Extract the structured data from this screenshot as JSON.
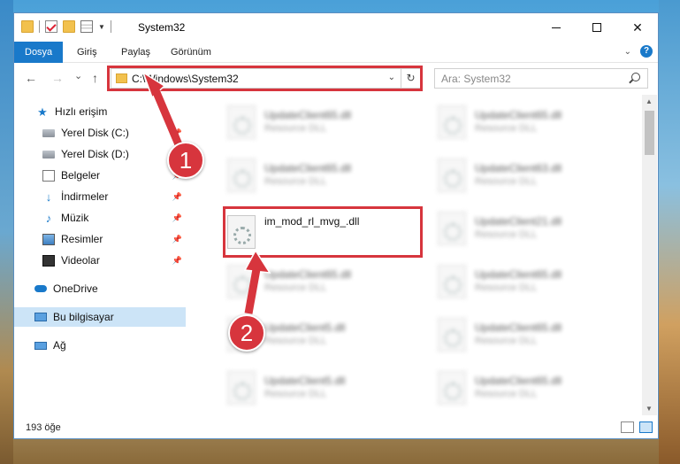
{
  "window": {
    "title": "System32",
    "minimize_glyph": "",
    "close_glyph": "✕"
  },
  "ribbon": {
    "tabs": [
      "Dosya",
      "Giriş",
      "Paylaş",
      "Görünüm"
    ],
    "active_tab": "Dosya",
    "help_glyph": "?"
  },
  "navigation": {
    "back_glyph": "←",
    "forward_glyph": "→",
    "recent_glyph": "⌄",
    "up_glyph": "↑",
    "address": "C:\\Windows\\System32",
    "refresh_glyph": "↻",
    "search_placeholder": "Ara: System32"
  },
  "sidebar": {
    "items": [
      {
        "label": "Hızlı erişim",
        "icon": "star-icon"
      },
      {
        "label": "Yerel Disk (C:)",
        "icon": "drive-icon"
      },
      {
        "label": "Yerel Disk (D:)",
        "icon": "drive-icon"
      },
      {
        "label": "Belgeler",
        "icon": "documents-icon"
      },
      {
        "label": "İndirmeler",
        "icon": "downloads-icon"
      },
      {
        "label": "Müzik",
        "icon": "music-icon"
      },
      {
        "label": "Resimler",
        "icon": "pictures-icon"
      },
      {
        "label": "Videolar",
        "icon": "videos-icon"
      },
      {
        "label": "OneDrive",
        "icon": "onedrive-icon"
      },
      {
        "label": "Bu bilgisayar",
        "icon": "this-pc-icon"
      },
      {
        "label": "Ağ",
        "icon": "network-icon"
      }
    ],
    "selected": "Bu bilgisayar"
  },
  "files": [
    {
      "name": "UpdateClient65.dll",
      "type": "Resource DLL"
    },
    {
      "name": "UpdateClient65.dll",
      "type": "Resource DLL"
    },
    {
      "name": "UpdateClient65.dll",
      "type": "Resource DLL"
    },
    {
      "name": "UpdateClient63.dll",
      "type": "Resource DLL"
    },
    {
      "name": "im_mod_rl_mvg_.dll",
      "type": ""
    },
    {
      "name": "UpdateClient21.dll",
      "type": "Resource DLL"
    },
    {
      "name": "UpdateClient65.dll",
      "type": "Resource DLL"
    },
    {
      "name": "UpdateClient65.dll",
      "type": "Resource DLL"
    },
    {
      "name": "UpdateClient5.dll",
      "type": "Resource DLL"
    },
    {
      "name": "UpdateClient65.dll",
      "type": "Resource DLL"
    },
    {
      "name": "UpdateClient5.dll",
      "type": "Resource DLL"
    },
    {
      "name": "UpdateClient65.dll",
      "type": "Resource DLL"
    }
  ],
  "status": {
    "item_count": "193 öğe"
  },
  "annotations": {
    "marker_1": "1",
    "marker_2": "2",
    "color": "#d7353d"
  }
}
